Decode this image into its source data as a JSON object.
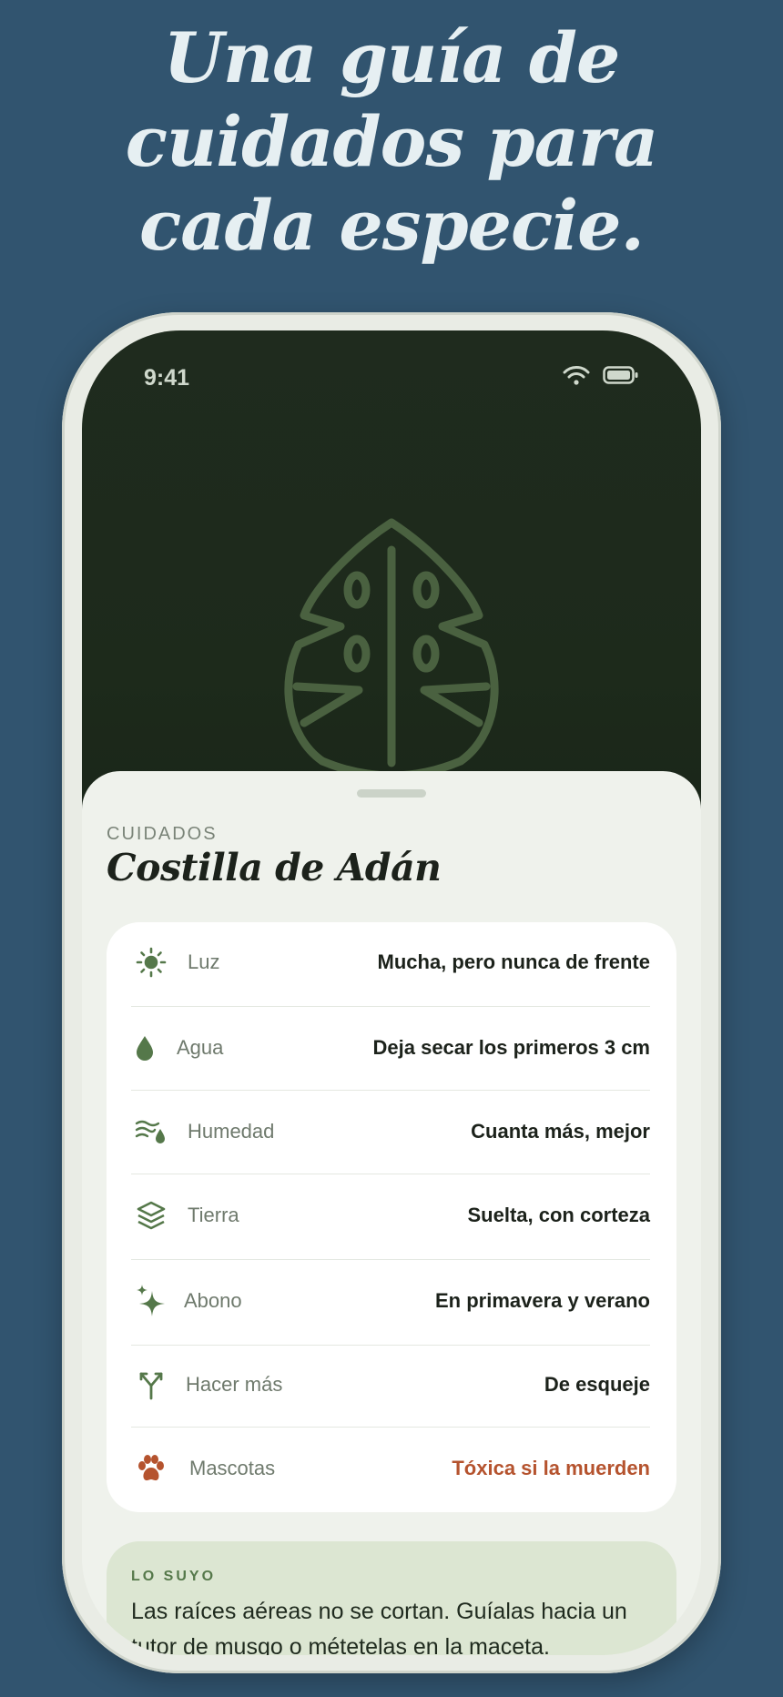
{
  "headline": {
    "line1": "Una guía de",
    "line2": "cuidados para",
    "line3": "cada especie."
  },
  "status_bar": {
    "time": "9:41",
    "icons": [
      "wifi-icon",
      "battery-icon"
    ]
  },
  "sheet": {
    "eyebrow": "CUIDADOS",
    "title": "Costilla de Adán",
    "rows": [
      {
        "icon": "sun-icon",
        "label": "Luz",
        "value": "Mucha, pero nunca de frente"
      },
      {
        "icon": "water-drop-icon",
        "label": "Agua",
        "value": "Deja secar los primeros 3 cm"
      },
      {
        "icon": "humidity-icon",
        "label": "Humedad",
        "value": "Cuanta más, mejor"
      },
      {
        "icon": "layers-icon",
        "label": "Tierra",
        "value": "Suelta, con corteza"
      },
      {
        "icon": "sparkle-icon",
        "label": "Abono",
        "value": "En primavera y verano"
      },
      {
        "icon": "branch-icon",
        "label": "Hacer más",
        "value": "De esqueje"
      },
      {
        "icon": "paw-icon",
        "label": "Mascotas",
        "value": "Tóxica si la muerden"
      }
    ],
    "tip": {
      "heading": "LO SUYO",
      "text": "Las raíces aéreas no se cortan. Guíalas hacia un tutor de musgo o métetelas en la maceta."
    }
  },
  "colors": {
    "background": "#31546f",
    "accent_green": "#55784a",
    "warning": "#b5532e",
    "hero_dark": "#1d2a1b"
  }
}
